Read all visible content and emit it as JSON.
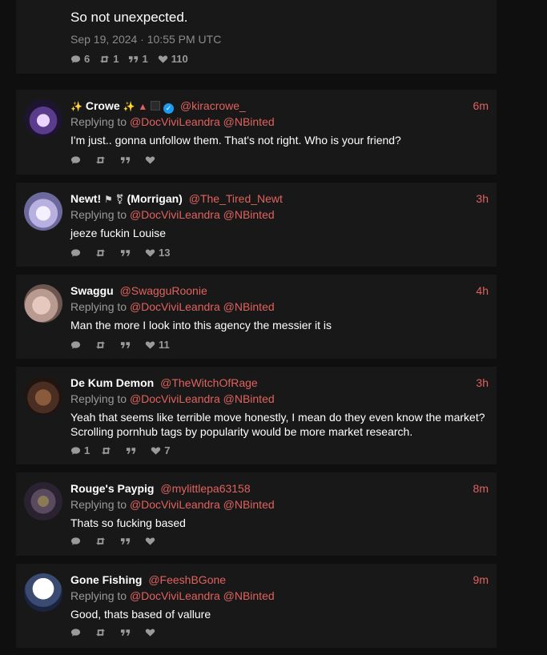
{
  "main_tweet": {
    "text": "So not unexpected.",
    "date": "Sep 19, 2024 · 10:55 PM UTC",
    "stats": {
      "replies": "6",
      "retweets": "1",
      "quotes": "1",
      "likes": "110"
    }
  },
  "replying_to_label": "Replying to",
  "replies": [
    {
      "name": "Crowe",
      "name_prefix": "✨",
      "name_suffix": "✨",
      "handle": "@kiracrowe_",
      "time": "6m",
      "mentions": [
        "@DocViviLeandra",
        "@NBinted"
      ],
      "text": "I'm just.. gonna unfollow them. That's not right.  Who is your friend?",
      "stats": {
        "replies": "",
        "retweets": "",
        "quotes": "",
        "likes": ""
      }
    },
    {
      "name": "Newt!",
      "name_suffix": "(Morrigan)",
      "handle": "@The_Tired_Newt",
      "time": "3h",
      "mentions": [
        "@DocViviLeandra",
        "@NBinted"
      ],
      "text": "jeeze fuckin Louise",
      "stats": {
        "replies": "",
        "retweets": "",
        "quotes": "",
        "likes": "13"
      }
    },
    {
      "name": "Swaggu",
      "handle": "@SwagguRoonie",
      "time": "4h",
      "mentions": [
        "@DocViviLeandra",
        "@NBinted"
      ],
      "text": "Man the more I look into this agency the messier it is",
      "stats": {
        "replies": "",
        "retweets": "",
        "quotes": "",
        "likes": "11"
      }
    },
    {
      "name": "De Kum Demon",
      "handle": "@TheWitchOfRage",
      "time": "3h",
      "mentions": [
        "@DocViviLeandra",
        "@NBinted"
      ],
      "text": "Yeah that seems like terrible move honestly, I mean do they even know the market? Scrolling pornhub tags by popularity would be more market research.",
      "stats": {
        "replies": "1",
        "retweets": "",
        "quotes": "",
        "likes": "7"
      }
    },
    {
      "name": "Rouge's Paypig",
      "handle": "@mylittlepa63158",
      "time": "8m",
      "mentions": [
        "@DocViviLeandra",
        "@NBinted"
      ],
      "text": "Thats so fucking based",
      "stats": {
        "replies": "",
        "retweets": "",
        "quotes": "",
        "likes": ""
      }
    },
    {
      "name": "Gone Fishing",
      "handle": "@FeeshBGone",
      "time": "9m",
      "mentions": [
        "@DocViviLeandra",
        "@NBinted"
      ],
      "text": "Good, thats based of vallure",
      "stats": {
        "replies": "",
        "retweets": "",
        "quotes": "",
        "likes": ""
      }
    }
  ],
  "colors": {
    "accent": "#e0625e",
    "card": "#181818",
    "background": "#0f0f0f",
    "muted": "#9a9a9a"
  }
}
